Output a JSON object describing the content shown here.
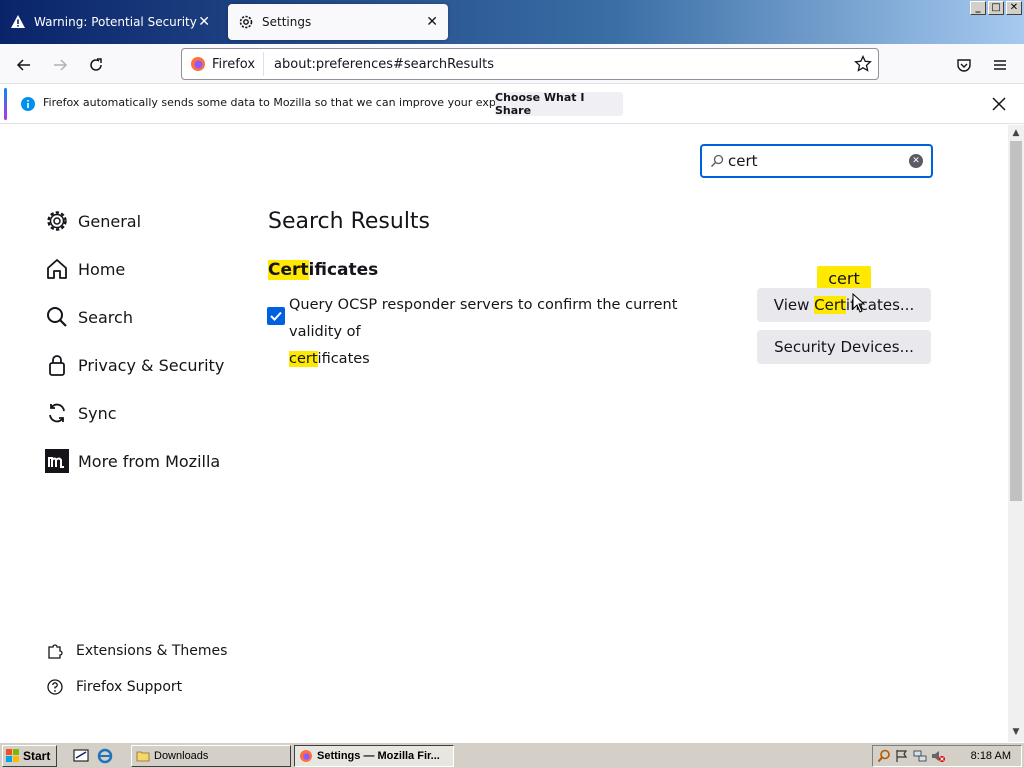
{
  "tabs": [
    {
      "title": "Warning: Potential Security Risk Ah",
      "active": false
    },
    {
      "title": "Settings",
      "active": true
    }
  ],
  "window_controls": {
    "minimize": "_",
    "maximize": "□",
    "close": "✕"
  },
  "navbar": {
    "identity_label": "Firefox",
    "url": "about:preferences#searchResults"
  },
  "notification": {
    "text": "Firefox automatically sends some data to Mozilla so that we can improve your experience.",
    "button_label": "Choose What I Share"
  },
  "search": {
    "value": "cert"
  },
  "sidebar": {
    "items": [
      {
        "label": "General",
        "icon": "gear-icon"
      },
      {
        "label": "Home",
        "icon": "home-icon"
      },
      {
        "label": "Search",
        "icon": "search-icon"
      },
      {
        "label": "Privacy & Security",
        "icon": "lock-icon"
      },
      {
        "label": "Sync",
        "icon": "sync-icon"
      },
      {
        "label": "More from Mozilla",
        "icon": "mozilla-icon"
      }
    ],
    "footer": [
      {
        "label": "Extensions & Themes",
        "icon": "puzzle-icon"
      },
      {
        "label": "Firefox Support",
        "icon": "help-icon"
      }
    ]
  },
  "main": {
    "title": "Search Results",
    "section": {
      "highlight": "Cert",
      "rest": "ificates"
    },
    "checkbox": {
      "checked": true,
      "label_line1": "Query OCSP responder servers to confirm the current validity of",
      "label_highlight": "cert",
      "label_rest": "ificates"
    },
    "buttons": {
      "view_pre": "View ",
      "view_highlight": "Cert",
      "view_post": "ificates...",
      "devices": "Security Devices..."
    },
    "tooltip": "cert"
  },
  "taskbar": {
    "start": "Start",
    "tasks": [
      {
        "label": "Downloads",
        "active": false
      },
      {
        "label": "Settings — Mozilla Fir...",
        "active": true
      }
    ],
    "clock": "8:18 AM"
  },
  "colors": {
    "accent": "#0061e0",
    "highlight": "#ffe900",
    "taskbar": "#d4d0c8"
  }
}
